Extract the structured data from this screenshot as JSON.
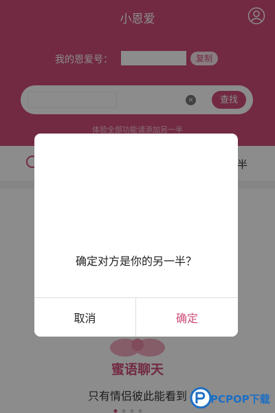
{
  "app": {
    "title": "小恩爱",
    "icons": {
      "profile": "person-circle-icon",
      "clear": "clear-circle-icon"
    },
    "account": {
      "label": "我的恩爱号：",
      "copy_label": "复制"
    },
    "search": {
      "button_label": "查找",
      "clear_glyph": "×"
    },
    "hint": "体验全部功能请添加另一半",
    "feature_bar": {
      "right_text": "半"
    },
    "intro": {
      "title": "蜜语聊天",
      "subtitle": "只有情侣彼此能看到"
    }
  },
  "dialog": {
    "message": "确定对方是你的另一半？",
    "cancel_label": "取消",
    "confirm_label": "确定"
  },
  "watermark": {
    "text": "PCPOP下载"
  },
  "colors": {
    "brand": "#cf4d7a",
    "overlay": "rgba(0,0,0,0.45)",
    "watermark_blue": "#1d6fc4"
  }
}
